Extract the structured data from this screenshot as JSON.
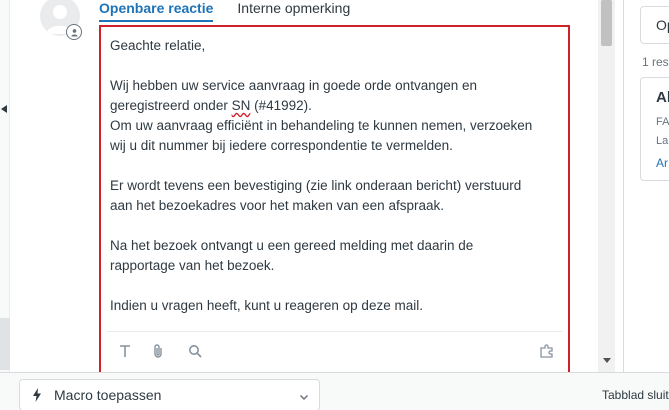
{
  "tabs": {
    "public_reply": "Openbare reactie",
    "internal_note": "Interne opmerking"
  },
  "editor": {
    "paragraphs": [
      "Geachte relatie,",
      "",
      "Wij hebben uw service aanvraag in goede orde ontvangen en",
      "geregistreerd onder |SN| (#41992).",
      "Om uw aanvraag efficiënt in behandeling te kunnen nemen, verzoeken",
      "wij u dit nummer bij iedere correspondentie te vermelden.",
      "",
      "Er wordt tevens een bevestiging (zie link onderaan bericht) verstuurd",
      "aan het bezoekadres voor het maken van een afspraak.",
      "",
      "Na het bezoek ontvangt u een gereed melding met daarin de",
      "rapportage van het bezoek.",
      "",
      "Indien u vragen heeft, kunt u reageren op deze mail."
    ],
    "toolbar_icons": [
      "text-format-icon",
      "attachment-icon",
      "search-icon",
      "apps-puzzle-icon"
    ],
    "highlight_color": "#d0202a"
  },
  "right_panel": {
    "button_label": "Op",
    "count_text": "1 res",
    "card_title": "Al",
    "card_line_1": "FA",
    "card_line_2": "La",
    "card_link": "Ar"
  },
  "footer": {
    "macro_label": "Macro toepassen",
    "tabblad_text": "Tabblad sluit"
  },
  "colors": {
    "accent": "#1f73b7",
    "text": "#2f3941"
  }
}
